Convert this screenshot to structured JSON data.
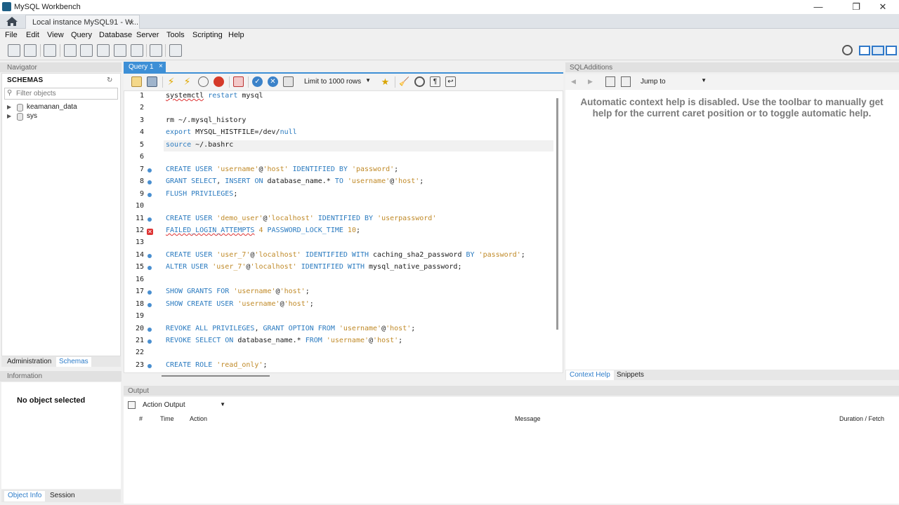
{
  "window": {
    "title": "MySQL Workbench",
    "controls": {
      "minimize": "—",
      "maximize": "❐",
      "close": "✕"
    }
  },
  "connection_tab": {
    "label": "Local instance MySQL91 - W...",
    "close": "×"
  },
  "menu": [
    "File",
    "Edit",
    "View",
    "Query",
    "Database",
    "Server",
    "Tools",
    "Scripting",
    "Help"
  ],
  "navigator": {
    "header": "Navigator",
    "schemas_title": "SCHEMAS",
    "filter_placeholder": "Filter objects",
    "schemas": [
      "keamanan_data",
      "sys"
    ],
    "tabs": [
      "Administration",
      "Schemas"
    ]
  },
  "information": {
    "header": "Information",
    "empty_text": "No object selected",
    "tabs": [
      "Object Info",
      "Session"
    ]
  },
  "query_tab": {
    "label": "Query 1",
    "close": "×"
  },
  "editor_toolbar": {
    "limit": "Limit to 1000 rows"
  },
  "editor": {
    "line_numbers": [
      "1",
      "2",
      "3",
      "4",
      "5",
      "6",
      "7",
      "8",
      "9",
      "10",
      "11",
      "12",
      "13",
      "14",
      "15",
      "16",
      "17",
      "18",
      "19",
      "20",
      "21",
      "22",
      "23"
    ],
    "lines": [
      [
        {
          "t": "systemctl",
          "c": "err"
        },
        {
          "t": " "
        },
        {
          "t": "restart",
          "c": "kw"
        },
        {
          "t": " mysql"
        }
      ],
      [],
      [
        {
          "t": "rm ~/.mysql_history"
        }
      ],
      [
        {
          "t": "export",
          "c": "kw"
        },
        {
          "t": " MYSQL_HISTFILE=/dev/"
        },
        {
          "t": "null",
          "c": "kw"
        }
      ],
      [
        {
          "t": "source",
          "c": "kw"
        },
        {
          "t": " ~/.bashrc"
        }
      ],
      [],
      [
        {
          "t": "CREATE USER ",
          "c": "kw"
        },
        {
          "t": "'username'",
          "c": "str"
        },
        {
          "t": "@"
        },
        {
          "t": "'host'",
          "c": "str"
        },
        {
          "t": " IDENTIFIED BY ",
          "c": "kw"
        },
        {
          "t": "'password'",
          "c": "str"
        },
        {
          "t": ";"
        }
      ],
      [
        {
          "t": "GRANT SELECT",
          "c": "kw"
        },
        {
          "t": ", "
        },
        {
          "t": "INSERT ON",
          "c": "kw"
        },
        {
          "t": " database_name.* "
        },
        {
          "t": "TO ",
          "c": "kw"
        },
        {
          "t": "'username'",
          "c": "str"
        },
        {
          "t": "@"
        },
        {
          "t": "'host'",
          "c": "str"
        },
        {
          "t": ";"
        }
      ],
      [
        {
          "t": "FLUSH PRIVILEGES",
          "c": "kw"
        },
        {
          "t": ";"
        }
      ],
      [],
      [
        {
          "t": "CREATE USER ",
          "c": "kw"
        },
        {
          "t": "'demo_user'",
          "c": "str"
        },
        {
          "t": "@"
        },
        {
          "t": "'localhost'",
          "c": "str"
        },
        {
          "t": " IDENTIFIED BY ",
          "c": "kw"
        },
        {
          "t": "'userpassword'",
          "c": "str"
        }
      ],
      [
        {
          "t": "FAILED_LOGIN_ATTEMPTS",
          "c": "kw err"
        },
        {
          "t": " "
        },
        {
          "t": "4",
          "c": "str"
        },
        {
          "t": " PASSWORD_LOCK_TIME ",
          "c": "kw"
        },
        {
          "t": "10",
          "c": "str"
        },
        {
          "t": ";"
        }
      ],
      [],
      [
        {
          "t": "CREATE USER ",
          "c": "kw"
        },
        {
          "t": "'user_7'",
          "c": "str"
        },
        {
          "t": "@"
        },
        {
          "t": "'localhost'",
          "c": "str"
        },
        {
          "t": " IDENTIFIED WITH",
          "c": "kw"
        },
        {
          "t": " caching_sha2_password "
        },
        {
          "t": "BY ",
          "c": "kw"
        },
        {
          "t": "'password'",
          "c": "str"
        },
        {
          "t": ";"
        }
      ],
      [
        {
          "t": "ALTER USER ",
          "c": "kw"
        },
        {
          "t": "'user_7'",
          "c": "str"
        },
        {
          "t": "@"
        },
        {
          "t": "'localhost'",
          "c": "str"
        },
        {
          "t": " IDENTIFIED WITH",
          "c": "kw"
        },
        {
          "t": " mysql_native_password;"
        }
      ],
      [],
      [
        {
          "t": "SHOW GRANTS FOR ",
          "c": "kw"
        },
        {
          "t": "'username'",
          "c": "str"
        },
        {
          "t": "@"
        },
        {
          "t": "'host'",
          "c": "str"
        },
        {
          "t": ";"
        }
      ],
      [
        {
          "t": "SHOW CREATE USER ",
          "c": "kw"
        },
        {
          "t": "'username'",
          "c": "str"
        },
        {
          "t": "@"
        },
        {
          "t": "'host'",
          "c": "str"
        },
        {
          "t": ";"
        }
      ],
      [],
      [
        {
          "t": "REVOKE ALL PRIVILEGES",
          "c": "kw"
        },
        {
          "t": ", "
        },
        {
          "t": "GRANT OPTION FROM ",
          "c": "kw"
        },
        {
          "t": "'username'",
          "c": "str"
        },
        {
          "t": "@"
        },
        {
          "t": "'host'",
          "c": "str"
        },
        {
          "t": ";"
        }
      ],
      [
        {
          "t": "REVOKE SELECT ON",
          "c": "kw"
        },
        {
          "t": " database_name.* "
        },
        {
          "t": "FROM ",
          "c": "kw"
        },
        {
          "t": "'username'",
          "c": "str"
        },
        {
          "t": "@"
        },
        {
          "t": "'host'",
          "c": "str"
        },
        {
          "t": ";"
        }
      ],
      [],
      [
        {
          "t": "CREATE ROLE ",
          "c": "kw"
        },
        {
          "t": "'read_only'",
          "c": "str"
        },
        {
          "t": ";"
        }
      ]
    ],
    "statement_markers": [
      "dot",
      "dot",
      "dot",
      "dot",
      "error",
      "dot",
      "dot",
      "dot",
      "dot",
      "dot",
      "dot",
      "dot"
    ]
  },
  "sql_additions": {
    "header": "SQLAdditions",
    "jump_to": "Jump to",
    "help_text": "Automatic context help is disabled. Use the toolbar to manually get help for the current caret position or to toggle automatic help.",
    "tabs": [
      "Context Help",
      "Snippets"
    ]
  },
  "output": {
    "header": "Output",
    "selector": "Action Output",
    "columns": [
      "#",
      "Time",
      "Action",
      "Message",
      "Duration / Fetch"
    ]
  },
  "colors": {
    "keyword": "#2b7bc0",
    "string": "#c08a28",
    "tab_active": "#3d8fd6",
    "error": "#d33333"
  }
}
